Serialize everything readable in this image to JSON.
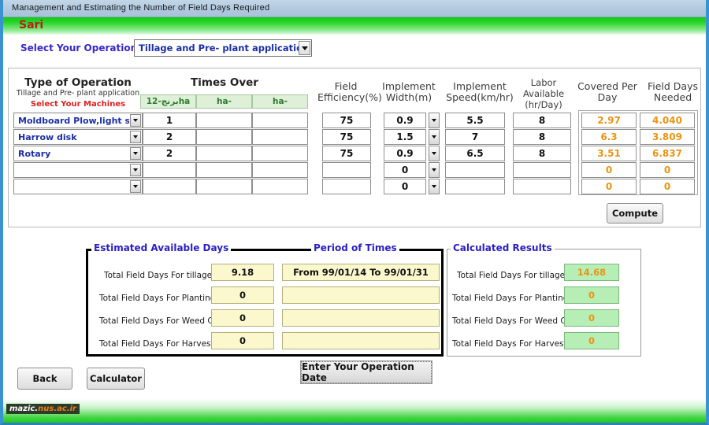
{
  "window": {
    "title": "Management and Estimating the Number of Field Days Required",
    "city": "Sari"
  },
  "operation": {
    "label": "Select Your Operation :",
    "selected": "Tillage and Pre- plant application",
    "dropdown_icon": "chevron-down-icon"
  },
  "table": {
    "headers": {
      "type_of_operation": "Type of Operation",
      "type_sub": "Tillage and Pre- plant application",
      "type_hint": "Select Your Machines",
      "times_over": "Times Over",
      "field_efficiency": "Field Efficiency(%)",
      "implement_width": "Implement Width(m)",
      "implement_speed": "Implement Speed(km/hr)",
      "labor_available": "Labor Available (hr/Day)",
      "covered_per_day": "Covered Per Day",
      "field_days_needed": "Field Days Needed"
    },
    "times_over_subheaders": [
      "برنج-12ha",
      "ha-",
      "ha-"
    ],
    "rows": [
      {
        "machine": "Moldboard Plow,light soil",
        "times_over": [
          "1",
          "",
          ""
        ],
        "field_efficiency": "75",
        "implement_width": "0.9",
        "implement_speed": "5.5",
        "labor_available": "8",
        "covered_per_day": "2.97",
        "field_days_needed": "4.040"
      },
      {
        "machine": "Harrow disk",
        "times_over": [
          "2",
          "",
          ""
        ],
        "field_efficiency": "75",
        "implement_width": "1.5",
        "implement_speed": "7",
        "labor_available": "8",
        "covered_per_day": "6.3",
        "field_days_needed": "3.809"
      },
      {
        "machine": "Rotary",
        "times_over": [
          "2",
          "",
          ""
        ],
        "field_efficiency": "75",
        "implement_width": "0.9",
        "implement_speed": "6.5",
        "labor_available": "8",
        "covered_per_day": "3.51",
        "field_days_needed": "6.837"
      },
      {
        "machine": "",
        "times_over": [
          "",
          "",
          ""
        ],
        "field_efficiency": "",
        "implement_width": "0",
        "implement_speed": "",
        "labor_available": "",
        "covered_per_day": "0",
        "field_days_needed": "0"
      },
      {
        "machine": "",
        "times_over": [
          "",
          "",
          ""
        ],
        "field_efficiency": "",
        "implement_width": "0",
        "implement_speed": "",
        "labor_available": "",
        "covered_per_day": "0",
        "field_days_needed": "0"
      }
    ]
  },
  "compute_button": "Compute",
  "estimated": {
    "group_label": "Estimated Available Days",
    "period_label": "Period  of  Times",
    "rows": [
      {
        "label": "Total Field Days For tillage",
        "days": "9.18",
        "period": "From  99/01/14  To  99/01/31"
      },
      {
        "label": "Total Field Days For Planting",
        "days": "0",
        "period": ""
      },
      {
        "label": "Total Field Days For Weed Control",
        "days": "0",
        "period": ""
      },
      {
        "label": "Total Field Days For Harvesting",
        "days": "0",
        "period": ""
      }
    ]
  },
  "calculated": {
    "group_label": "Calculated Results",
    "rows": [
      {
        "label": "Total Field Days For tillage",
        "value": "14.68"
      },
      {
        "label": "Total Field Days For Planting",
        "value": "0"
      },
      {
        "label": "Total Field Days For Weed Control",
        "value": "0"
      },
      {
        "label": "Total Field Days For Harvesting",
        "value": "0"
      }
    ]
  },
  "buttons": {
    "back": "Back",
    "calculator": "Calculator",
    "operation_date": "Enter Your Operation Date"
  },
  "watermark": {
    "part1": "mazic.",
    "part2": "nus.ac.ir"
  },
  "colors": {
    "accent_blue": "#3a93d0",
    "banner_green": "#17c717",
    "city_red": "#b02318",
    "label_blue": "#2a1ec4",
    "value_orange": "#eb9413",
    "yellow_field": "#fbf8cd",
    "green_field": "#b6eeb6"
  }
}
